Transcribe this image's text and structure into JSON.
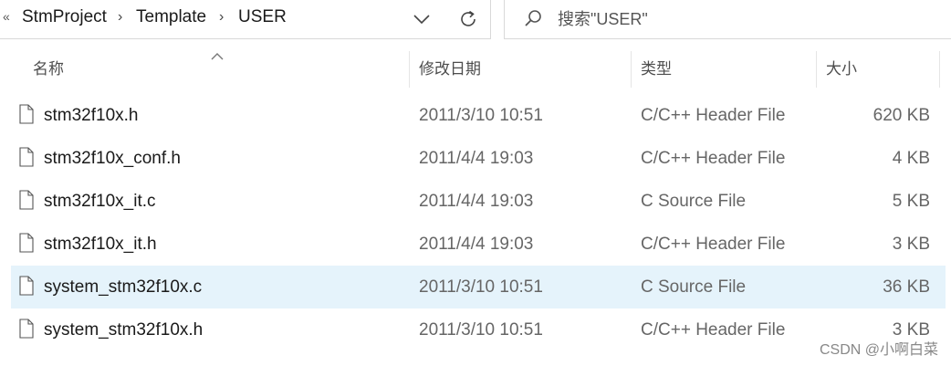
{
  "breadcrumb": {
    "overflow": "«",
    "items": [
      "StmProject",
      "Template",
      "USER"
    ]
  },
  "search": {
    "placeholder": "搜索\"USER\""
  },
  "columns": {
    "name": "名称",
    "date": "修改日期",
    "type": "类型",
    "size": "大小"
  },
  "files": [
    {
      "name": "stm32f10x.h",
      "date": "2011/3/10 10:51",
      "type": "C/C++ Header File",
      "size": "620 KB",
      "selected": false
    },
    {
      "name": "stm32f10x_conf.h",
      "date": "2011/4/4 19:03",
      "type": "C/C++ Header File",
      "size": "4 KB",
      "selected": false
    },
    {
      "name": "stm32f10x_it.c",
      "date": "2011/4/4 19:03",
      "type": "C Source File",
      "size": "5 KB",
      "selected": false
    },
    {
      "name": "stm32f10x_it.h",
      "date": "2011/4/4 19:03",
      "type": "C/C++ Header File",
      "size": "3 KB",
      "selected": false
    },
    {
      "name": "system_stm32f10x.c",
      "date": "2011/3/10 10:51",
      "type": "C Source File",
      "size": "36 KB",
      "selected": true
    },
    {
      "name": "system_stm32f10x.h",
      "date": "2011/3/10 10:51",
      "type": "C/C++ Header File",
      "size": "3 KB",
      "selected": false
    }
  ],
  "watermark": "CSDN @小啊白菜",
  "colors": {
    "selection": "#e5f3fb",
    "divider": "#d9d9d9"
  },
  "icons": [
    "chevron-down-icon",
    "refresh-icon",
    "search-icon",
    "sort-up-icon",
    "file-icon"
  ]
}
